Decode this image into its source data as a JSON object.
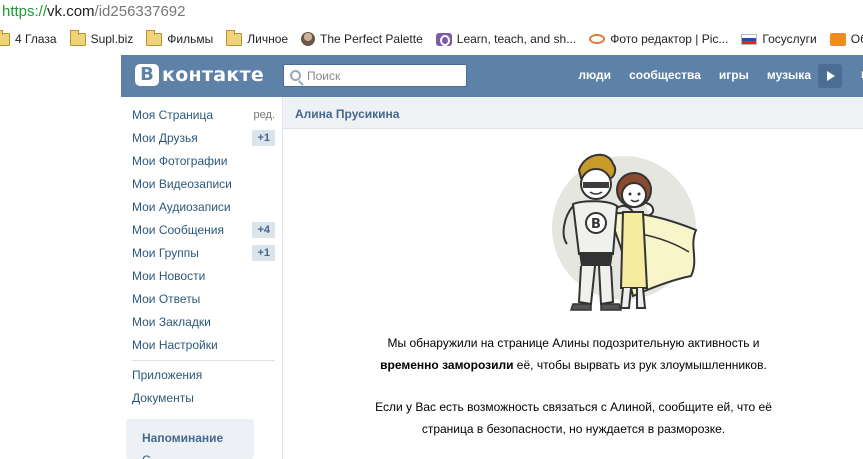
{
  "browser": {
    "url_scheme": "https://",
    "url_host": "vk.com",
    "url_path": "/id256337692",
    "bookmarks": [
      {
        "label": "4 Глаза",
        "icon": "folder-icon"
      },
      {
        "label": "Supl.biz",
        "icon": "folder-icon"
      },
      {
        "label": "Фильмы",
        "icon": "folder-icon"
      },
      {
        "label": "Личное",
        "icon": "folder-icon"
      },
      {
        "label": "The Perfect Palette",
        "icon": "avatar-icon"
      },
      {
        "label": "Learn, teach, and sh...",
        "icon": "purple-icon"
      },
      {
        "label": "Фото редактор | Pic...",
        "icon": "photo-editor-icon"
      },
      {
        "label": "Госуслуги",
        "icon": "russian-flag-icon"
      },
      {
        "label": "Обзо",
        "icon": "orange-icon"
      }
    ]
  },
  "header": {
    "logo_letter": "В",
    "logo_word": "контакте",
    "search_placeholder": "Поиск",
    "nav": [
      "люди",
      "сообщества",
      "игры",
      "музыка"
    ],
    "cut_text": "п"
  },
  "sidebar": {
    "items": [
      {
        "label": "Моя Страница",
        "extra": "ред."
      },
      {
        "label": "Мои Друзья",
        "badge": "+1"
      },
      {
        "label": "Мои Фотографии"
      },
      {
        "label": "Мои Видеозаписи"
      },
      {
        "label": "Мои Аудиозаписи"
      },
      {
        "label": "Мои Сообщения",
        "badge": "+4"
      },
      {
        "label": "Мои Группы",
        "badge": "+1"
      },
      {
        "label": "Мои Новости"
      },
      {
        "label": "Мои Ответы"
      },
      {
        "label": "Мои Закладки"
      },
      {
        "label": "Мои Настройки"
      }
    ],
    "extra_items": [
      "Приложения",
      "Документы"
    ],
    "reminder_title": "Напоминание",
    "reminder_sub": "С"
  },
  "main": {
    "title": "Алина Прусикина",
    "line1": "Мы обнаружили на странице Алины подозрительную активность и",
    "line2_bold": "временно заморозили",
    "line2_rest": " её, чтобы вырвать из рук злоумышленников.",
    "line3": "Если у Вас есть возможность связаться с Алиной, сообщите ей, что её",
    "line4": "страница в безопасности, но нуждается в разморозке."
  },
  "colors": {
    "vk_blue": "#5e81a8",
    "link": "#2b587a",
    "badge_bg": "#dbe3eb",
    "title_bg": "#eef2f5"
  }
}
